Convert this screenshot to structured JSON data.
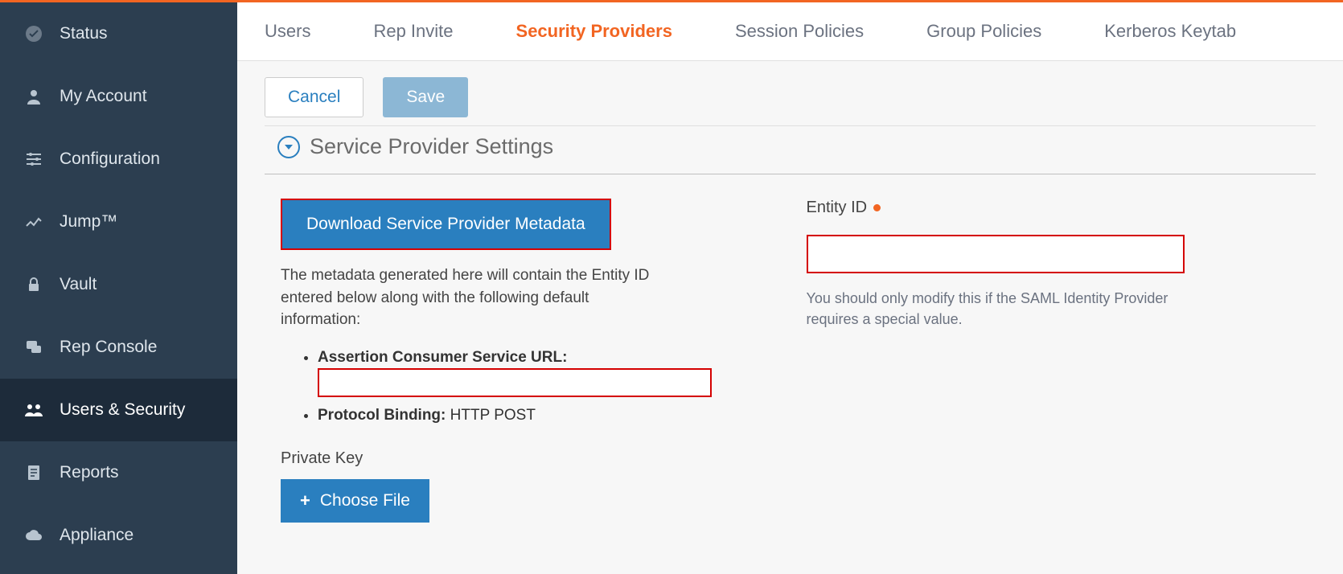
{
  "sidebar": {
    "items": [
      {
        "label": "Status"
      },
      {
        "label": "My Account"
      },
      {
        "label": "Configuration"
      },
      {
        "label": "Jump™"
      },
      {
        "label": "Vault"
      },
      {
        "label": "Rep Console"
      },
      {
        "label": "Users & Security"
      },
      {
        "label": "Reports"
      },
      {
        "label": "Appliance"
      }
    ]
  },
  "tabs": {
    "items": [
      {
        "label": "Users"
      },
      {
        "label": "Rep Invite"
      },
      {
        "label": "Security Providers"
      },
      {
        "label": "Session Policies"
      },
      {
        "label": "Group Policies"
      },
      {
        "label": "Kerberos Keytab"
      }
    ]
  },
  "buttons": {
    "cancel": "Cancel",
    "save": "Save"
  },
  "panel": {
    "title": "Service Provider Settings",
    "download_btn": "Download Service Provider Metadata",
    "desc": "The metadata generated here will contain the Entity ID entered below along with the following default information:",
    "acs_label": "Assertion Consumer Service URL:",
    "protocol_label": "Protocol Binding:",
    "protocol_value": " HTTP POST",
    "private_key_label": "Private Key",
    "choose_file": "Choose File",
    "entity_label": "Entity ID",
    "entity_help": "You should only modify this if the SAML Identity Provider requires a special value."
  }
}
